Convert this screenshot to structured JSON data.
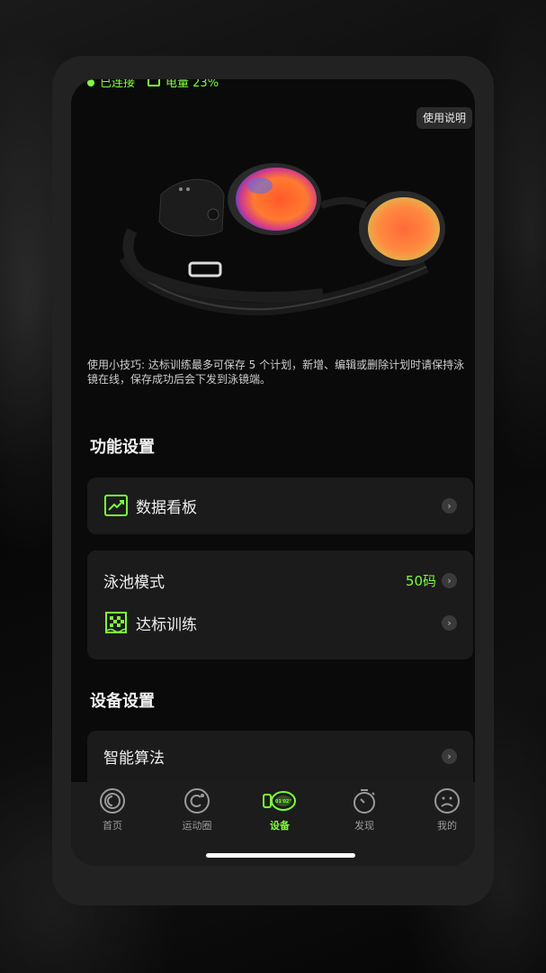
{
  "status": {
    "connection": "已连接",
    "battery": "电量 23%"
  },
  "help_button": "使用说明",
  "tip": "使用小技巧: 达标训练最多可保存 5 个计划，新增、编辑或删除计划时请保持泳镜在线，保存成功后会下发到泳镜端。",
  "function_settings": {
    "title": "功能设置",
    "dashboard": "数据看板",
    "pool_mode": {
      "label": "泳池模式",
      "value": "50码"
    },
    "target_training": "达标训练"
  },
  "device_settings": {
    "title": "设备设置",
    "smart_algorithm": "智能算法"
  },
  "tabs": [
    {
      "label": "首页",
      "icon": "home-icon"
    },
    {
      "label": "运动圈",
      "icon": "sport-circle-icon"
    },
    {
      "label": "设备",
      "icon": "goggles-icon",
      "active": true
    },
    {
      "label": "发现",
      "icon": "stopwatch-icon"
    },
    {
      "label": "我的",
      "icon": "profile-icon"
    }
  ],
  "colors": {
    "accent": "#7cfc3c",
    "background": "#0a0a0a",
    "card": "#1b1b1b"
  }
}
